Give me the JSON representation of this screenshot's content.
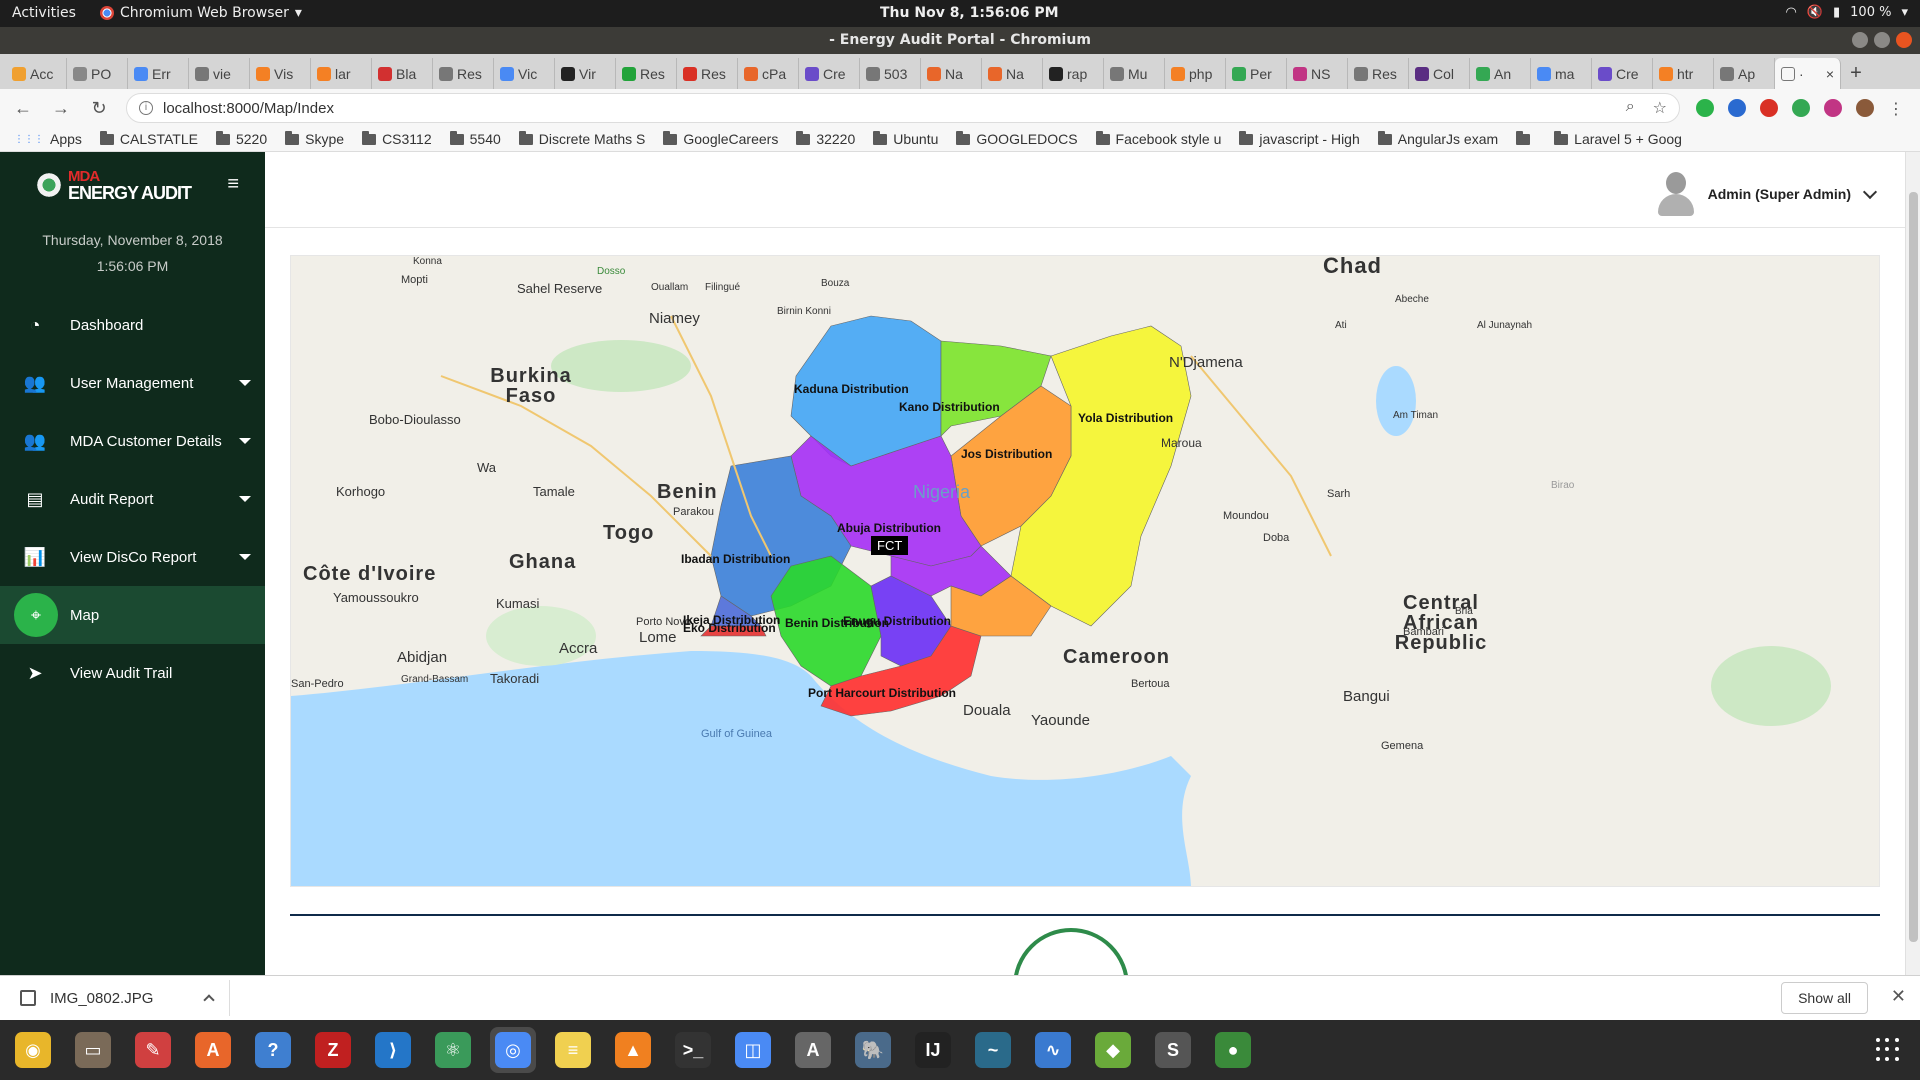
{
  "system": {
    "activities": "Activities",
    "app_name": "Chromium Web Browser",
    "clock": "Thu Nov  8,  1:56:06 PM",
    "battery": "100 %"
  },
  "window": {
    "title": "- Energy Audit Portal - Chromium"
  },
  "tabs": [
    {
      "label": "Acc",
      "color": "#f0a030"
    },
    {
      "label": "PO",
      "color": "#888888"
    },
    {
      "label": "Err",
      "color": "#4a8af4"
    },
    {
      "label": "vie",
      "color": "#777777"
    },
    {
      "label": "Vis",
      "color": "#f48024"
    },
    {
      "label": "lar",
      "color": "#f48024"
    },
    {
      "label": "Bla",
      "color": "#d23030"
    },
    {
      "label": "Res",
      "color": "#777777"
    },
    {
      "label": "Vic",
      "color": "#4a8af4"
    },
    {
      "label": "Vir",
      "color": "#222222"
    },
    {
      "label": "Res",
      "color": "#22a33a"
    },
    {
      "label": "Res",
      "color": "#d93025"
    },
    {
      "label": "cPa",
      "color": "#e8662a"
    },
    {
      "label": "Cre",
      "color": "#6a4cc9"
    },
    {
      "label": "503",
      "color": "#777777"
    },
    {
      "label": "Na",
      "color": "#e8662a"
    },
    {
      "label": "Na",
      "color": "#e8662a"
    },
    {
      "label": "rap",
      "color": "#222222"
    },
    {
      "label": "Mu",
      "color": "#777777"
    },
    {
      "label": "php",
      "color": "#f48024"
    },
    {
      "label": "Per",
      "color": "#34a853"
    },
    {
      "label": "NS",
      "color": "#c13584"
    },
    {
      "label": "Res",
      "color": "#777777"
    },
    {
      "label": "Col",
      "color": "#5a2d82"
    },
    {
      "label": "An",
      "color": "#34a853"
    },
    {
      "label": "ma",
      "color": "#4a8af4"
    },
    {
      "label": "Cre",
      "color": "#6a4cc9"
    },
    {
      "label": "htr",
      "color": "#f48024"
    },
    {
      "label": "Ap",
      "color": "#777777"
    }
  ],
  "active_tab": {
    "label": "·",
    "close": "×"
  },
  "new_tab": "+",
  "address": {
    "url": "localhost:8000/Map/Index"
  },
  "bookmarks": [
    "Apps",
    "CALSTATLE",
    "5220",
    "Skype",
    "CS3112",
    "5540",
    "Discrete Maths S",
    "GoogleCareers",
    "32220",
    "Ubuntu",
    "GOOGLEDOCS",
    "Facebook style u",
    "javascript - High",
    "AngularJs exam",
    "",
    "Laravel 5 + Goog"
  ],
  "sidebar": {
    "logo_top": "MDA",
    "logo_bottom": "ENERGY AUDIT",
    "date": "Thursday, November 8, 2018",
    "time": "1:56:06 PM",
    "items": [
      {
        "label": "Dashboard",
        "icon": "dashboard-icon"
      },
      {
        "label": "User Management",
        "icon": "users-icon"
      },
      {
        "label": "MDA Customer Details",
        "icon": "customers-icon"
      },
      {
        "label": "Audit Report",
        "icon": "report-icon"
      },
      {
        "label": "View DisCo Report",
        "icon": "chart-icon"
      },
      {
        "label": "Map",
        "icon": "map-pin-icon"
      },
      {
        "label": "View Audit Trail",
        "icon": "send-icon"
      }
    ]
  },
  "header": {
    "user": "Admin (Super Admin)"
  },
  "map": {
    "countries": [
      "Chad",
      "Burkina Faso",
      "Benin",
      "Togo",
      "Ghana",
      "Côte d'Ivoire",
      "Cameroon",
      "Central African Republic",
      "Nigeria"
    ],
    "places": [
      "Niamey",
      "N'Djamena",
      "Sahel Reserve",
      "Bobo-Dioulasso",
      "Tamale",
      "Kumasi",
      "Yamoussoukro",
      "Abidjan",
      "Takoradi",
      "Accra",
      "Lome",
      "Porto Novo",
      "Parakou",
      "Korhogo",
      "Wa",
      "Douala",
      "Yaounde",
      "Bangui",
      "Bertoua",
      "Maroua",
      "Moundou",
      "Sarh",
      "Doba",
      "Gemena",
      "Bambari",
      "Gulf of Guinea",
      "San-Pedro",
      "Grand-Bassam",
      "Konna",
      "Mopti",
      "Ouallam",
      "Filingué",
      "Bouza",
      "Abeche",
      "Ati",
      "Al Junaynah",
      "Am Timan",
      "Birao",
      "Bria",
      "Dosso",
      "Birnin Konni"
    ],
    "regions": [
      {
        "name": "Kaduna Distribution",
        "color": "#42a5f5"
      },
      {
        "name": "Kano Distribution",
        "color": "#7be32a"
      },
      {
        "name": "Yola Distribution",
        "color": "#f5f52a"
      },
      {
        "name": "Jos Distribution",
        "color": "#ff9a2e"
      },
      {
        "name": "Abuja Distribution",
        "color": "#a52ef5"
      },
      {
        "name": "Ibadan Distribution",
        "color": "#3b7fd9"
      },
      {
        "name": "Ikeja Distribution",
        "color": "#4d6bd9"
      },
      {
        "name": "Eko Distribution",
        "color": "#e53030"
      },
      {
        "name": "Benin Distribution",
        "color": "#2ad82a"
      },
      {
        "name": "Enugu Distribution",
        "color": "#6a2ef5"
      },
      {
        "name": "Port Harcourt Distribution",
        "color": "#ff2e2e"
      }
    ],
    "fct": "FCT"
  },
  "downloads": {
    "file": "IMG_0802.JPG",
    "show_all": "Show all"
  },
  "dock": [
    {
      "name": "rhythmbox",
      "color": "#e8b62a",
      "glyph": "◉"
    },
    {
      "name": "files",
      "color": "#7a6a58",
      "glyph": "▭"
    },
    {
      "name": "texteditor",
      "color": "#d04040",
      "glyph": "✎"
    },
    {
      "name": "software",
      "color": "#e8662a",
      "glyph": "A"
    },
    {
      "name": "help",
      "color": "#3f7fd0",
      "glyph": "?"
    },
    {
      "name": "filezilla",
      "color": "#c02020",
      "glyph": "Z"
    },
    {
      "name": "vscode",
      "color": "#2476c8",
      "glyph": "⟩"
    },
    {
      "name": "atom",
      "color": "#3a9a5a",
      "glyph": "⚛"
    },
    {
      "name": "chromium",
      "color": "#4a8af4",
      "glyph": "◎"
    },
    {
      "name": "notes",
      "color": "#f0d050",
      "glyph": "≡"
    },
    {
      "name": "vlc",
      "color": "#f08020",
      "glyph": "▲"
    },
    {
      "name": "terminal",
      "color": "#333333",
      "glyph": ">_"
    },
    {
      "name": "screenshot",
      "color": "#4a8af4",
      "glyph": "◫"
    },
    {
      "name": "update",
      "color": "#666666",
      "glyph": "A"
    },
    {
      "name": "postgres",
      "color": "#4a6a8a",
      "glyph": "🐘"
    },
    {
      "name": "intellij",
      "color": "#222222",
      "glyph": "IJ"
    },
    {
      "name": "mysql",
      "color": "#2a6a8a",
      "glyph": "~"
    },
    {
      "name": "monitor",
      "color": "#3a7ad0",
      "glyph": "∿"
    },
    {
      "name": "android",
      "color": "#6aaa3a",
      "glyph": "◆"
    },
    {
      "name": "sublime",
      "color": "#555555",
      "glyph": "S"
    },
    {
      "name": "mongodb",
      "color": "#3a8a3a",
      "glyph": "●"
    }
  ]
}
